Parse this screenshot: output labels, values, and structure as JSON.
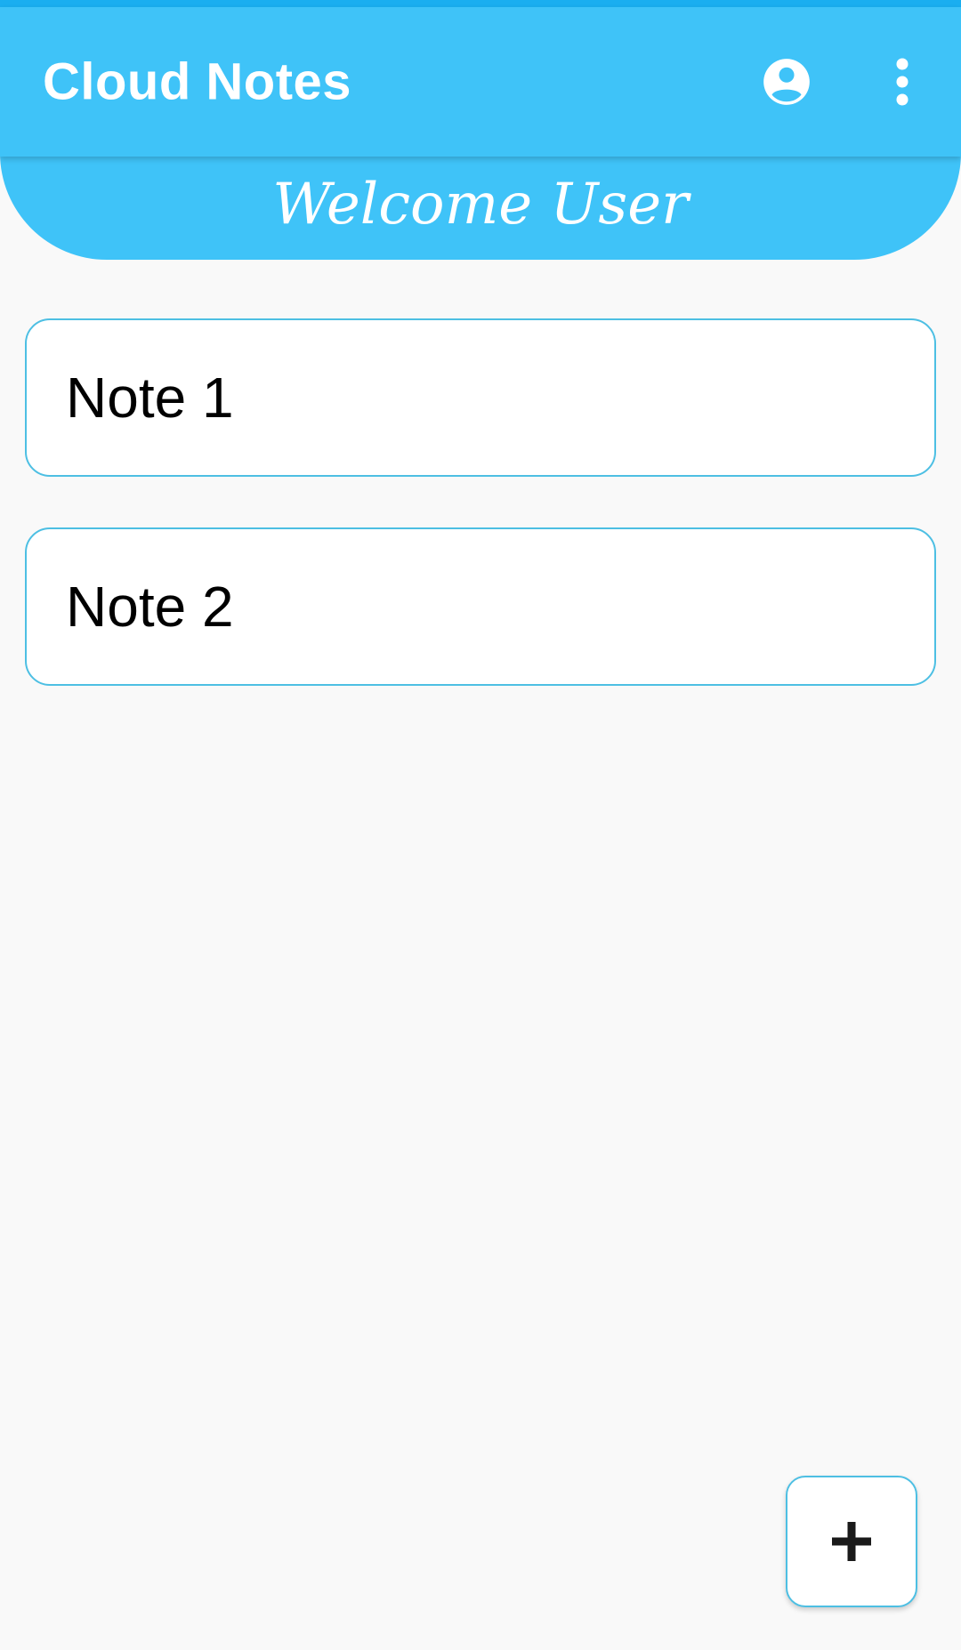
{
  "app_bar": {
    "title": "Cloud Notes",
    "account_icon": "account-circle-icon",
    "menu_icon": "more-vert-icon",
    "background_color": "#3fc3f8"
  },
  "welcome": {
    "text": "Welcome User"
  },
  "notes": [
    {
      "title": "Note 1"
    },
    {
      "title": "Note 2"
    }
  ],
  "fab": {
    "icon": "add-icon"
  },
  "colors": {
    "accent": "#3fc3f8",
    "card_border": "#4dbfe3",
    "page_background": "#f9f9f9"
  }
}
